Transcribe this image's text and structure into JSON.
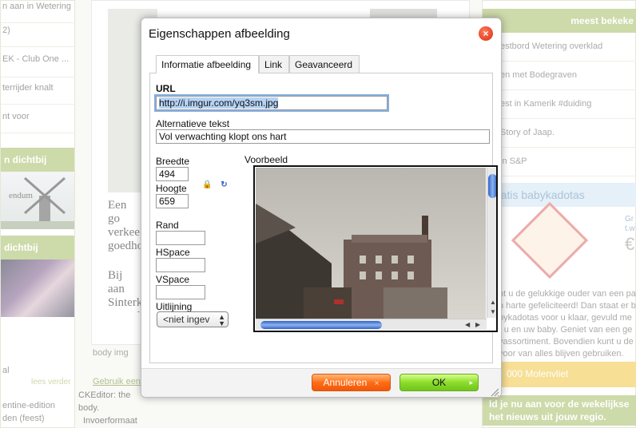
{
  "background": {
    "left_items": [
      "n aan in Wetering",
      "2)",
      "EK - Club One ...",
      "terrijder knalt",
      "nt voor"
    ],
    "left_heading_1": "n dichtbij",
    "left_image_caption": "endum",
    "left_heading_2": "dichtbij",
    "left_bottom_items": [
      "al",
      "entine-edition",
      "den (feest)"
    ],
    "lees_verder": "lees verder",
    "right_heading": "meest bekeke",
    "right_items": [
      "estbord Wetering overklad",
      "en met Bodegraven",
      "est in Kamerik #duiding",
      "Story of Jaap.",
      "in S&P"
    ],
    "promo_title": "ratis babykadotas",
    "promo_side": "Gr",
    "promo_side2": "t.w",
    "promo_euro": "€",
    "promo_text": "nt u de gelukkige ouder van een pa n harte gefeliciteerd! Dan staat er b bykadotas voor u klaar, gevuld me r u en uw baby. Geniet van een ge yassortiment. Bovendien kunt u de voor van alles blijven gebruiken.",
    "promo_bar": "000 Molenvliet",
    "newsletter": "ld je nu aan voor de wekelijkse het nieuws uit jouw regio.",
    "editor_text_1": "Een go verkee goedho vol nos",
    "editor_text_2": "Bij aan Sinterk mantel",
    "editor_path": "body  img",
    "use_link": "Gebruik een 'K",
    "ck_note": "CKEditor: the",
    "body_label": "body.",
    "input_format": "Invoerformaat"
  },
  "dialog": {
    "title": "Eigenschappen afbeelding",
    "close_symbol": "×",
    "tabs": [
      {
        "label": "Informatie afbeelding",
        "active": true
      },
      {
        "label": "Link",
        "active": false
      },
      {
        "label": "Geavanceerd",
        "active": false
      }
    ],
    "url_label": "URL",
    "url_value": "http://i.imgur.com/yq3sm.jpg",
    "alt_label": "Alternatieve tekst",
    "alt_value": "Vol verwachting klopt ons hart",
    "width_label": "Breedte",
    "width_value": "494",
    "height_label": "Hoogte",
    "height_value": "659",
    "border_label": "Rand",
    "border_value": "",
    "hspace_label": "HSpace",
    "hspace_value": "",
    "vspace_label": "VSpace",
    "vspace_value": "",
    "align_label": "Uitlijning",
    "align_value": "<niet ingev",
    "preview_label": "Voorbeeld",
    "cancel_label": "Annuleren",
    "cancel_symbol": "×",
    "ok_label": "OK",
    "ok_symbol": "▸",
    "lock_icon_symbol": "🔒",
    "reset_icon_symbol": "↻"
  },
  "colors": {
    "green_accent": "#a5bc64",
    "cancel_orange": "#ff6d16",
    "ok_green": "#8cdc2c",
    "close_red": "#d62d10",
    "scroll_blue": "#2e63c8"
  }
}
